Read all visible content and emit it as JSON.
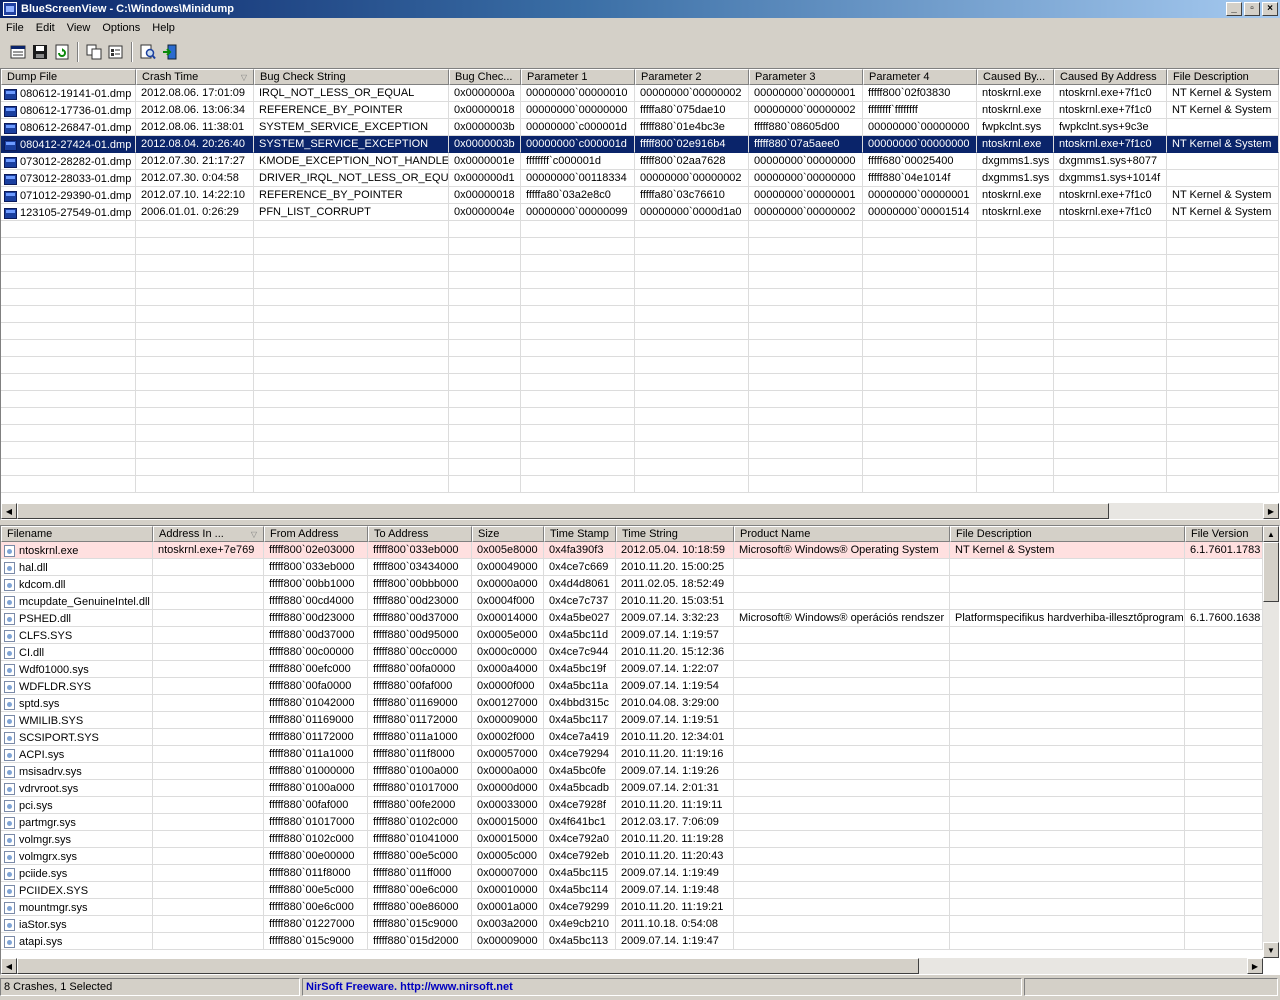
{
  "window": {
    "title": "BlueScreenView  -  C:\\Windows\\Minidump"
  },
  "menu": [
    "File",
    "Edit",
    "View",
    "Options",
    "Help"
  ],
  "toolbar": [
    "properties-list-icon",
    "save-icon",
    "refresh-icon",
    "copy-icon",
    "properties-icon",
    "find-icon",
    "exit-icon"
  ],
  "crash_columns": [
    "Dump File",
    "Crash Time",
    "Bug Check String",
    "Bug Chec...",
    "Parameter 1",
    "Parameter 2",
    "Parameter 3",
    "Parameter 4",
    "Caused By...",
    "Caused By Address",
    "File Description"
  ],
  "crashes": [
    [
      "080612-19141-01.dmp",
      "2012.08.06. 17:01:09",
      "IRQL_NOT_LESS_OR_EQUAL",
      "0x0000000a",
      "00000000`00000010",
      "00000000`00000002",
      "00000000`00000001",
      "fffff800`02f03830",
      "ntoskrnl.exe",
      "ntoskrnl.exe+7f1c0",
      "NT Kernel & System"
    ],
    [
      "080612-17736-01.dmp",
      "2012.08.06. 13:06:34",
      "REFERENCE_BY_POINTER",
      "0x00000018",
      "00000000`00000000",
      "fffffa80`075dae10",
      "00000000`00000002",
      "ffffffff`ffffffff",
      "ntoskrnl.exe",
      "ntoskrnl.exe+7f1c0",
      "NT Kernel & System"
    ],
    [
      "080612-26847-01.dmp",
      "2012.08.06. 11:38:01",
      "SYSTEM_SERVICE_EXCEPTION",
      "0x0000003b",
      "00000000`c000001d",
      "fffff880`01e4bc3e",
      "fffff880`08605d00",
      "00000000`00000000",
      "fwpkclnt.sys",
      "fwpkclnt.sys+9c3e",
      ""
    ],
    [
      "080412-27424-01.dmp",
      "2012.08.04. 20:26:40",
      "SYSTEM_SERVICE_EXCEPTION",
      "0x0000003b",
      "00000000`c000001d",
      "fffff800`02e916b4",
      "fffff880`07a5aee0",
      "00000000`00000000",
      "ntoskrnl.exe",
      "ntoskrnl.exe+7f1c0",
      "NT Kernel & System"
    ],
    [
      "073012-28282-01.dmp",
      "2012.07.30. 21:17:27",
      "KMODE_EXCEPTION_NOT_HANDLED",
      "0x0000001e",
      "ffffffff`c000001d",
      "fffff800`02aa7628",
      "00000000`00000000",
      "fffff680`00025400",
      "dxgmms1.sys",
      "dxgmms1.sys+8077",
      ""
    ],
    [
      "073012-28033-01.dmp",
      "2012.07.30. 0:04:58",
      "DRIVER_IRQL_NOT_LESS_OR_EQUAL",
      "0x000000d1",
      "00000000`00118334",
      "00000000`00000002",
      "00000000`00000000",
      "fffff880`04e1014f",
      "dxgmms1.sys",
      "dxgmms1.sys+1014f",
      ""
    ],
    [
      "071012-29390-01.dmp",
      "2012.07.10. 14:22:10",
      "REFERENCE_BY_POINTER",
      "0x00000018",
      "fffffa80`03a2e8c0",
      "fffffa80`03c76610",
      "00000000`00000001",
      "00000000`00000001",
      "ntoskrnl.exe",
      "ntoskrnl.exe+7f1c0",
      "NT Kernel & System"
    ],
    [
      "123105-27549-01.dmp",
      "2006.01.01. 0:26:29",
      "PFN_LIST_CORRUPT",
      "0x0000004e",
      "00000000`00000099",
      "00000000`0000d1a0",
      "00000000`00000002",
      "00000000`00001514",
      "ntoskrnl.exe",
      "ntoskrnl.exe+7f1c0",
      "NT Kernel & System"
    ]
  ],
  "selected_crash": 3,
  "driver_columns": [
    "Filename",
    "Address In ...",
    "From Address",
    "To Address",
    "Size",
    "Time Stamp",
    "Time String",
    "Product Name",
    "File Description",
    "File Version"
  ],
  "drivers": [
    [
      "ntoskrnl.exe",
      "ntoskrnl.exe+7e769",
      "fffff800`02e03000",
      "fffff800`033eb000",
      "0x005e8000",
      "0x4fa390f3",
      "2012.05.04. 10:18:59",
      "Microsoft® Windows® Operating System",
      "NT Kernel & System",
      "6.1.7601.1783"
    ],
    [
      "hal.dll",
      "",
      "fffff800`033eb000",
      "fffff800`03434000",
      "0x00049000",
      "0x4ce7c669",
      "2010.11.20. 15:00:25",
      "",
      "",
      ""
    ],
    [
      "kdcom.dll",
      "",
      "fffff800`00bb1000",
      "fffff800`00bbb000",
      "0x0000a000",
      "0x4d4d8061",
      "2011.02.05. 18:52:49",
      "",
      "",
      ""
    ],
    [
      "mcupdate_GenuineIntel.dll",
      "",
      "fffff880`00cd4000",
      "fffff880`00d23000",
      "0x0004f000",
      "0x4ce7c737",
      "2010.11.20. 15:03:51",
      "",
      "",
      ""
    ],
    [
      "PSHED.dll",
      "",
      "fffff880`00d23000",
      "fffff880`00d37000",
      "0x00014000",
      "0x4a5be027",
      "2009.07.14. 3:32:23",
      "Microsoft® Windows® operációs rendszer",
      "Platformspecifikus hardverhiba-illesztőprogram",
      "6.1.7600.1638"
    ],
    [
      "CLFS.SYS",
      "",
      "fffff880`00d37000",
      "fffff880`00d95000",
      "0x0005e000",
      "0x4a5bc11d",
      "2009.07.14. 1:19:57",
      "",
      "",
      ""
    ],
    [
      "CI.dll",
      "",
      "fffff880`00c00000",
      "fffff880`00cc0000",
      "0x000c0000",
      "0x4ce7c944",
      "2010.11.20. 15:12:36",
      "",
      "",
      ""
    ],
    [
      "Wdf01000.sys",
      "",
      "fffff880`00efc000",
      "fffff880`00fa0000",
      "0x000a4000",
      "0x4a5bc19f",
      "2009.07.14. 1:22:07",
      "",
      "",
      ""
    ],
    [
      "WDFLDR.SYS",
      "",
      "fffff880`00fa0000",
      "fffff880`00faf000",
      "0x0000f000",
      "0x4a5bc11a",
      "2009.07.14. 1:19:54",
      "",
      "",
      ""
    ],
    [
      "sptd.sys",
      "",
      "fffff880`01042000",
      "fffff880`01169000",
      "0x00127000",
      "0x4bbd315c",
      "2010.04.08. 3:29:00",
      "",
      "",
      ""
    ],
    [
      "WMILIB.SYS",
      "",
      "fffff880`01169000",
      "fffff880`01172000",
      "0x00009000",
      "0x4a5bc117",
      "2009.07.14. 1:19:51",
      "",
      "",
      ""
    ],
    [
      "SCSIPORT.SYS",
      "",
      "fffff880`01172000",
      "fffff880`011a1000",
      "0x0002f000",
      "0x4ce7a419",
      "2010.11.20. 12:34:01",
      "",
      "",
      ""
    ],
    [
      "ACPI.sys",
      "",
      "fffff880`011a1000",
      "fffff880`011f8000",
      "0x00057000",
      "0x4ce79294",
      "2010.11.20. 11:19:16",
      "",
      "",
      ""
    ],
    [
      "msisadrv.sys",
      "",
      "fffff880`01000000",
      "fffff880`0100a000",
      "0x0000a000",
      "0x4a5bc0fe",
      "2009.07.14. 1:19:26",
      "",
      "",
      ""
    ],
    [
      "vdrvroot.sys",
      "",
      "fffff880`0100a000",
      "fffff880`01017000",
      "0x0000d000",
      "0x4a5bcadb",
      "2009.07.14. 2:01:31",
      "",
      "",
      ""
    ],
    [
      "pci.sys",
      "",
      "fffff880`00faf000",
      "fffff880`00fe2000",
      "0x00033000",
      "0x4ce7928f",
      "2010.11.20. 11:19:11",
      "",
      "",
      ""
    ],
    [
      "partmgr.sys",
      "",
      "fffff880`01017000",
      "fffff880`0102c000",
      "0x00015000",
      "0x4f641bc1",
      "2012.03.17. 7:06:09",
      "",
      "",
      ""
    ],
    [
      "volmgr.sys",
      "",
      "fffff880`0102c000",
      "fffff880`01041000",
      "0x00015000",
      "0x4ce792a0",
      "2010.11.20. 11:19:28",
      "",
      "",
      ""
    ],
    [
      "volmgrx.sys",
      "",
      "fffff880`00e00000",
      "fffff880`00e5c000",
      "0x0005c000",
      "0x4ce792eb",
      "2010.11.20. 11:20:43",
      "",
      "",
      ""
    ],
    [
      "pciide.sys",
      "",
      "fffff880`011f8000",
      "fffff880`011ff000",
      "0x00007000",
      "0x4a5bc115",
      "2009.07.14. 1:19:49",
      "",
      "",
      ""
    ],
    [
      "PCIIDEX.SYS",
      "",
      "fffff880`00e5c000",
      "fffff880`00e6c000",
      "0x00010000",
      "0x4a5bc114",
      "2009.07.14. 1:19:48",
      "",
      "",
      ""
    ],
    [
      "mountmgr.sys",
      "",
      "fffff880`00e6c000",
      "fffff880`00e86000",
      "0x0001a000",
      "0x4ce79299",
      "2010.11.20. 11:19:21",
      "",
      "",
      ""
    ],
    [
      "iaStor.sys",
      "",
      "fffff880`01227000",
      "fffff880`015c9000",
      "0x003a2000",
      "0x4e9cb210",
      "2011.10.18. 0:54:08",
      "",
      "",
      ""
    ],
    [
      "atapi.sys",
      "",
      "fffff880`015c9000",
      "fffff880`015d2000",
      "0x00009000",
      "0x4a5bc113",
      "2009.07.14. 1:19:47",
      "",
      "",
      ""
    ]
  ],
  "highlighted_driver": 0,
  "status": {
    "count": "8 Crashes, 1 Selected",
    "freeware": "NirSoft Freeware.  http://www.nirsoft.net"
  }
}
